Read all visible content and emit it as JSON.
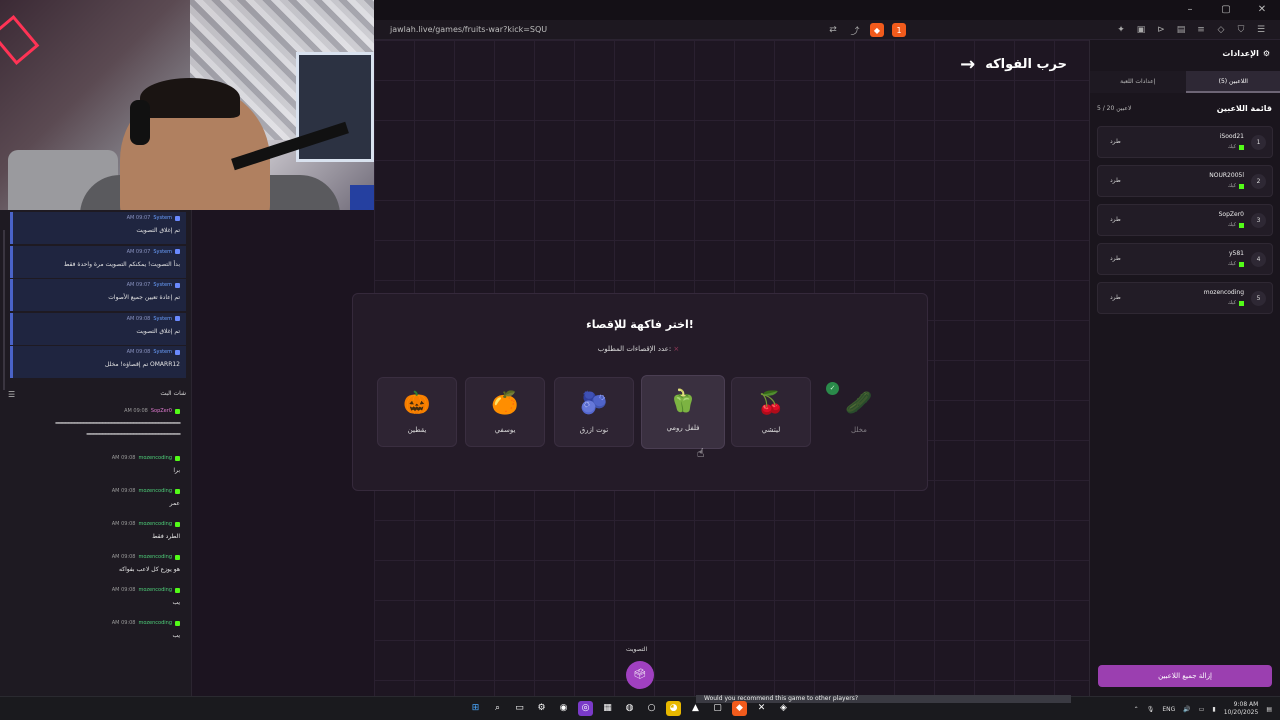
{
  "browser": {
    "url": "jawlah.live/games/fruits-war?kick=SQU",
    "brave_badge": "1",
    "window_controls": [
      "–",
      "▢",
      "✕"
    ]
  },
  "stream_chat": {
    "system_messages": [
      {
        "time": "AM 09:07",
        "user": "System",
        "text": "تم إغلاق التصويت"
      },
      {
        "time": "AM 09:07",
        "user": "System",
        "text": "بدأ التصويت! يمكنكم التصويت مرة واحدة فقط"
      },
      {
        "time": "AM 09:07",
        "user": "System",
        "text": "تم إعادة تعيين جميع الأصوات"
      },
      {
        "time": "AM 09:08",
        "user": "System",
        "text": "تم إغلاق التصويت"
      },
      {
        "time": "AM 09:08",
        "user": "System",
        "text": "OMARR12 تم إقصاؤه! مخلل"
      }
    ],
    "chat_title": "شات البث",
    "messages": [
      {
        "time": "AM 09:08",
        "user": "SopZer0",
        "text": "━━━━━━━━━━━━━━━━━━━━━━━━━━━━━━━━━━━━━━━━",
        "text2": "━━━━━━━━━━━━━━━━━━━━━━━━━━━━━━"
      },
      {
        "time": "AM 09:08",
        "user": "mozencoding",
        "text": "برا"
      },
      {
        "time": "AM 09:08",
        "user": "mozencoding",
        "text": "عمر"
      },
      {
        "time": "AM 09:08",
        "user": "mozencoding",
        "text": "الطرد فقط"
      },
      {
        "time": "AM 09:08",
        "user": "mozencoding",
        "text": "هو يوزع كل لاعب بفواكه"
      },
      {
        "time": "AM 09:08",
        "user": "mozencoding",
        "text": "يب"
      },
      {
        "time": "AM 09:08",
        "user": "mozencoding",
        "text": "يب"
      }
    ]
  },
  "game": {
    "title": "حرب الفواكه",
    "modal_title": "اختر فاكهة للإقصاء!",
    "modal_subtitle": "عدد الإقصاءات المطلوب:",
    "modal_subtitle_x": "×",
    "fruits": [
      {
        "icon": "🎃",
        "label": "يقطين"
      },
      {
        "icon": "🍊",
        "label": "يوسفي"
      },
      {
        "icon": "🫐",
        "label": "توت ازرق"
      },
      {
        "icon": "🫑",
        "label": "فلفل رومي"
      },
      {
        "icon": "🍒",
        "label": "ليتشي"
      },
      {
        "icon": "🥒",
        "label": "مخلل"
      }
    ],
    "eliminated_badge": "✓",
    "vote_label": "التصويت",
    "vote_icon": "🗳"
  },
  "settings": {
    "title": "الإعدادات",
    "tabs": [
      "إعدادات اللعبة",
      "اللاعبين (5)"
    ],
    "players_title": "قائمة اللاعبين",
    "players_count": "5 / 20 لاعبين",
    "kick_label": "طرد",
    "status_label": "كيك",
    "players": [
      {
        "num": "1",
        "name": "iSood21"
      },
      {
        "num": "2",
        "name": "NOUR2005l"
      },
      {
        "num": "3",
        "name": "SopZer0"
      },
      {
        "num": "4",
        "name": "y581"
      },
      {
        "num": "5",
        "name": "mozencoding"
      }
    ],
    "remove_all": "إزالة جميع اللاعبين"
  },
  "taskbar": {
    "caption": "Would you recommend this game to other players?",
    "lang": "ENG",
    "time": "9:08 AM",
    "date": "10/20/2025"
  }
}
